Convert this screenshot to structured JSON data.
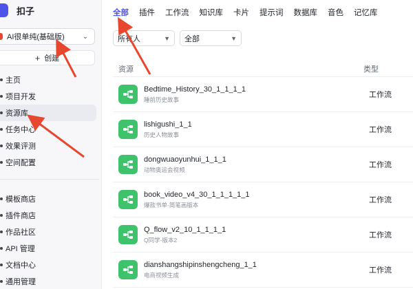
{
  "app": {
    "name": "扣子"
  },
  "sidebar": {
    "workspace": "AI很单纯(基础版)",
    "create_label": "创建",
    "nav_group_1": [
      {
        "label": "主页",
        "active": false
      },
      {
        "label": "项目开发",
        "active": false
      },
      {
        "label": "资源库",
        "active": true
      },
      {
        "label": "任务中心",
        "active": false
      },
      {
        "label": "效果评测",
        "active": false
      },
      {
        "label": "空间配置",
        "active": false
      }
    ],
    "nav_group_2": [
      {
        "label": "模板商店"
      },
      {
        "label": "插件商店"
      },
      {
        "label": "作品社区"
      },
      {
        "label": "API 管理"
      },
      {
        "label": "文档中心"
      },
      {
        "label": "通用管理"
      }
    ]
  },
  "main": {
    "tabs": [
      {
        "label": "全部",
        "active": true
      },
      {
        "label": "插件"
      },
      {
        "label": "工作流"
      },
      {
        "label": "知识库"
      },
      {
        "label": "卡片"
      },
      {
        "label": "提示词"
      },
      {
        "label": "数据库"
      },
      {
        "label": "音色"
      },
      {
        "label": "记忆库"
      }
    ],
    "filters": {
      "owner": "所有人",
      "type": "全部"
    },
    "table": {
      "col_resource": "资源",
      "col_type": "类型",
      "rows": [
        {
          "title": "Bedtime_History_30_1_1_1_1",
          "subtitle": "睡前历史故事",
          "type": "工作流"
        },
        {
          "title": "lishigushi_1_1",
          "subtitle": "历史人物故事",
          "type": "工作流"
        },
        {
          "title": "dongwuaoyunhui_1_1_1",
          "subtitle": "动物奥运会视频",
          "type": "工作流"
        },
        {
          "title": "book_video_v4_30_1_1_1_1_1",
          "subtitle": "爆款书单-简笔画版本",
          "type": "工作流"
        },
        {
          "title": "Q_flow_v2_10_1_1_1_1",
          "subtitle": "Q同学-版本2",
          "type": "工作流"
        },
        {
          "title": "dianshangshipinshengcheng_1_1",
          "subtitle": "电商视频生成",
          "type": "工作流"
        }
      ]
    }
  },
  "colors": {
    "accent": "#4d53e8",
    "workflow_icon": "#3ec26b",
    "annotation_arrow": "#e8472f"
  }
}
